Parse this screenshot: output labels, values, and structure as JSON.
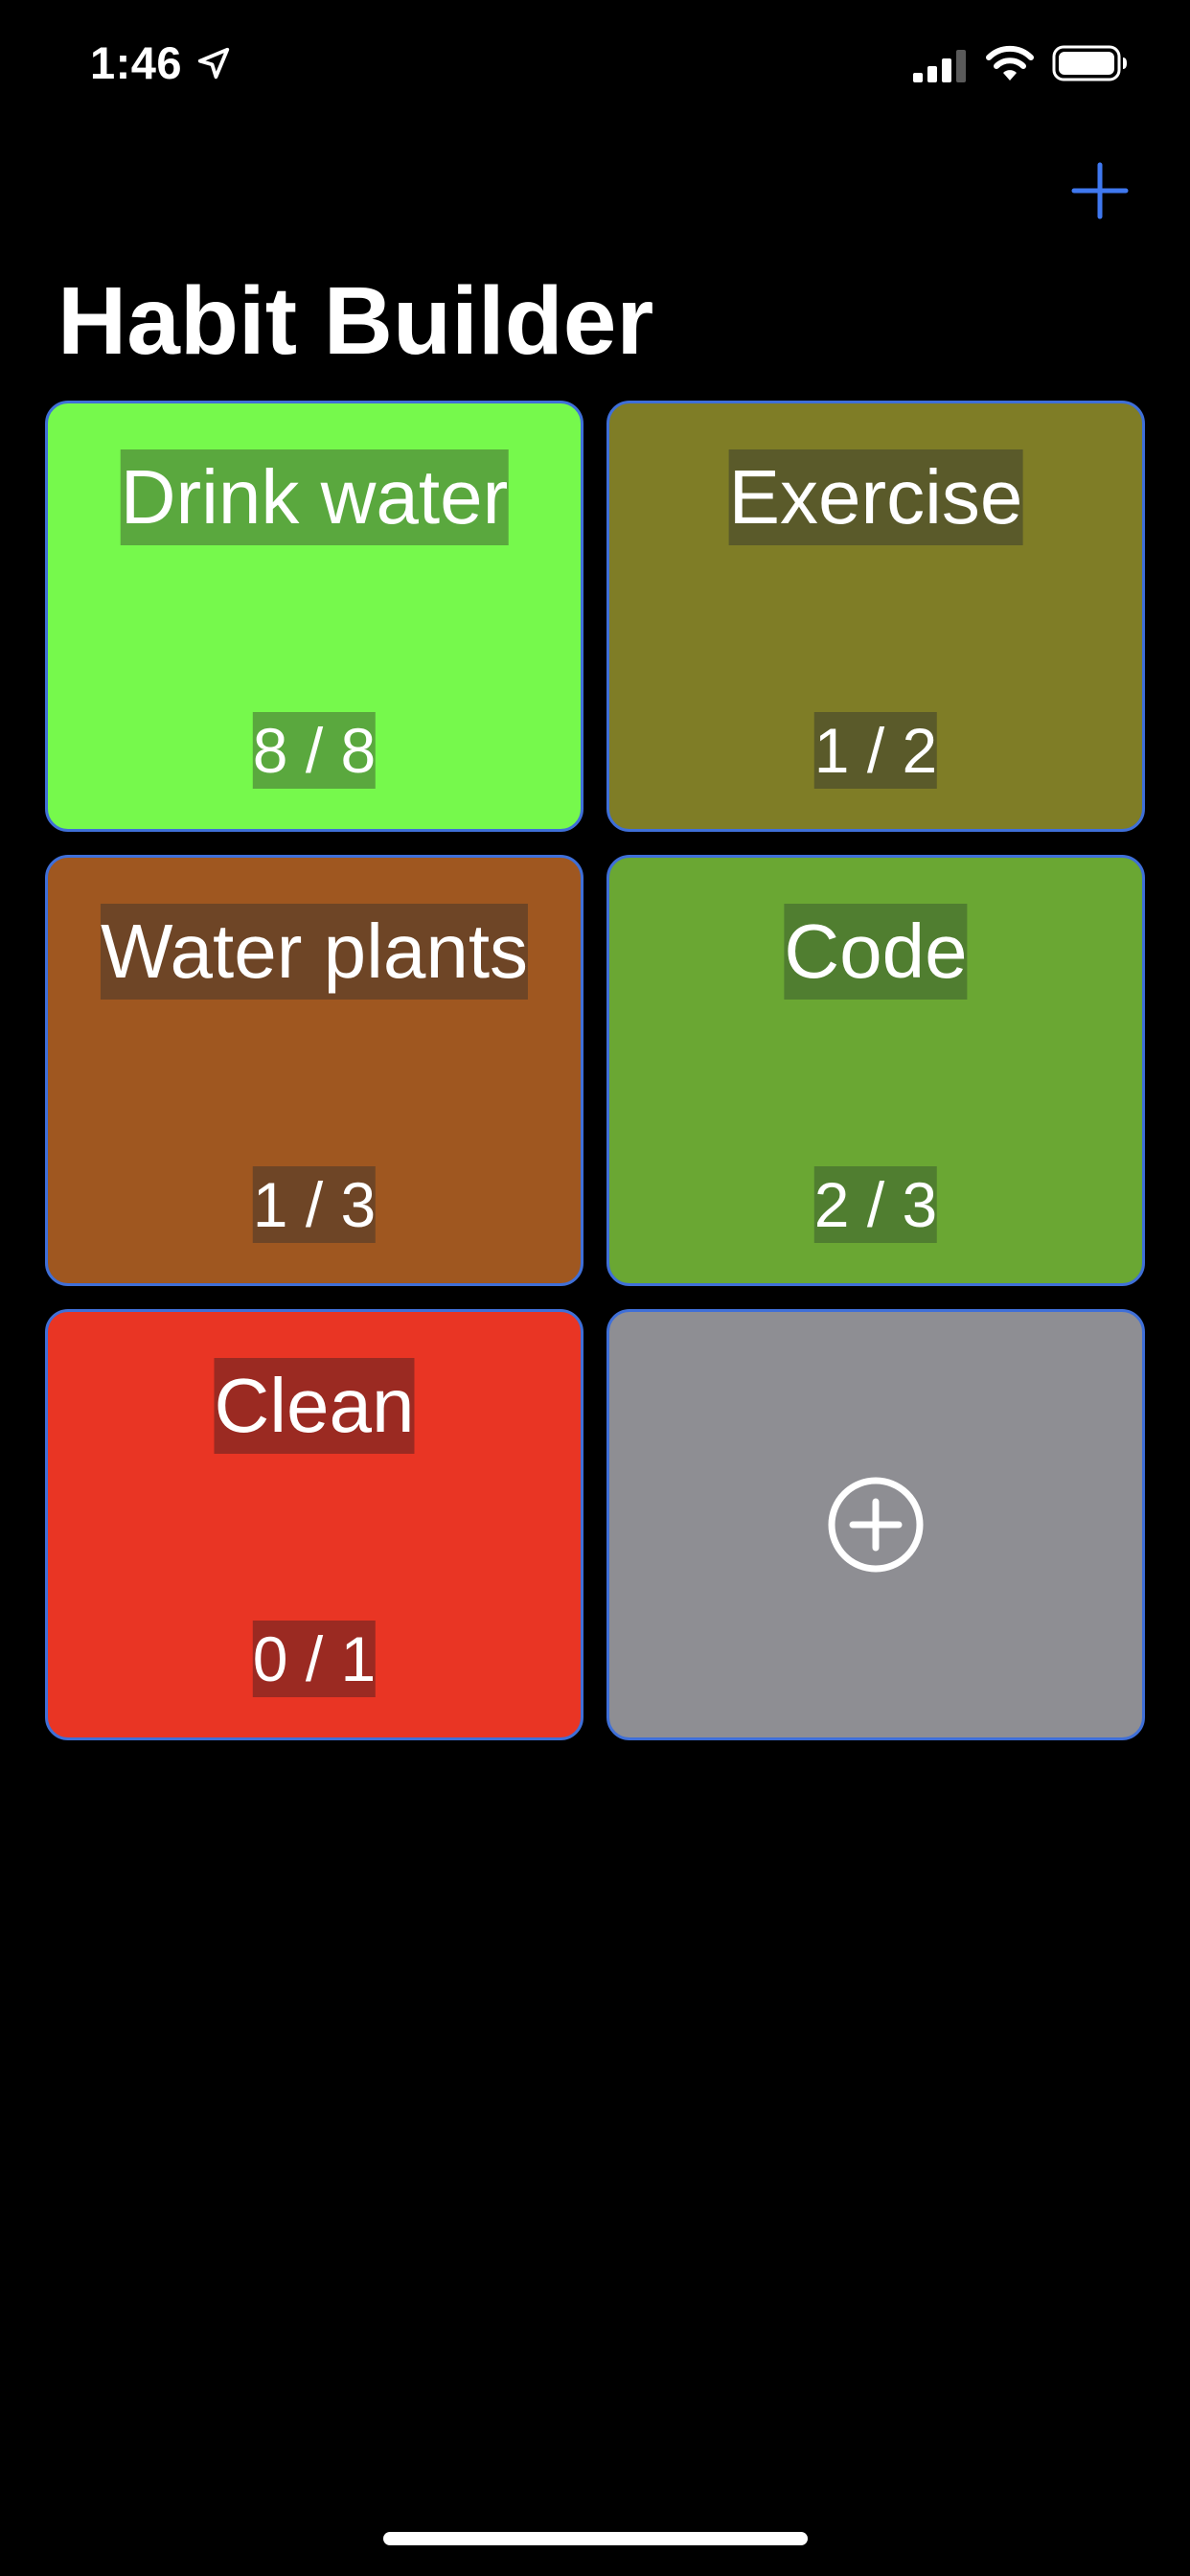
{
  "status_bar": {
    "time": "1:46",
    "icons": [
      "location-arrow-icon",
      "cellular-signal-icon",
      "wifi-icon",
      "battery-icon"
    ]
  },
  "nav": {
    "add_icon": "plus-icon",
    "accent_color": "#3f78f0"
  },
  "page": {
    "title": "Habit Builder"
  },
  "habits": [
    {
      "name": "Drink water",
      "count": "8 / 8",
      "color": "#76f94c",
      "label_bg": "#5aa83e"
    },
    {
      "name": "Exercise",
      "count": "1 / 2",
      "color": "#7f7d26",
      "label_bg": "#5a5a2a"
    },
    {
      "name": "Water plants",
      "count": "1 / 3",
      "color": "#9f5720",
      "label_bg": "#6e4526"
    },
    {
      "name": "Code",
      "count": "2 / 3",
      "color": "#6aa733",
      "label_bg": "#507e30"
    },
    {
      "name": "Clean",
      "count": "0 / 1",
      "color": "#e93524",
      "label_bg": "#9b2a22"
    }
  ],
  "add_tile": {
    "icon": "plus-circle-icon",
    "color": "#8e8e93"
  },
  "tile_border_color": "#3f6fd8"
}
